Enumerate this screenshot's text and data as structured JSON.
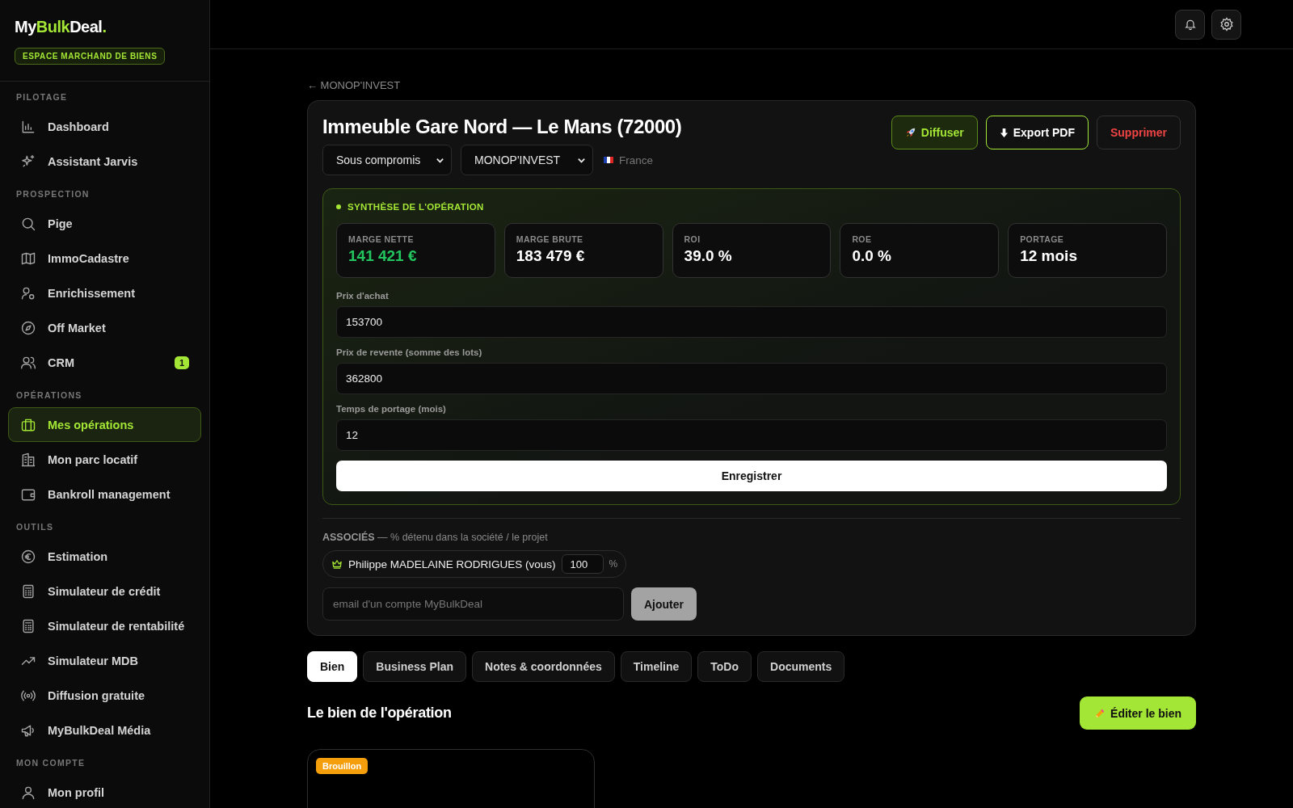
{
  "logo": {
    "parts": [
      {
        "text": "My",
        "accent": false
      },
      {
        "text": "Bulk",
        "accent": true
      },
      {
        "text": "Deal",
        "accent": false
      },
      {
        "text": ".",
        "accent": true
      }
    ]
  },
  "space_badge": "ESPACE MARCHAND DE BIENS",
  "sidebar": {
    "sections": [
      {
        "title": "PILOTAGE",
        "items": [
          {
            "label": "Dashboard",
            "selected": false
          },
          {
            "label": "Assistant Jarvis",
            "selected": false
          }
        ]
      },
      {
        "title": "PROSPECTION",
        "items": [
          {
            "label": "Pige",
            "selected": false
          },
          {
            "label": "ImmoCadastre",
            "selected": false
          },
          {
            "label": "Enrichissement",
            "selected": false
          },
          {
            "label": "Off Market",
            "selected": false
          },
          {
            "label": "CRM",
            "selected": false,
            "badge": "1"
          }
        ]
      },
      {
        "title": "OPÉRATIONS",
        "items": [
          {
            "label": "Mes opérations",
            "selected": true
          },
          {
            "label": "Mon parc locatif",
            "selected": false
          },
          {
            "label": "Bankroll management",
            "selected": false
          }
        ]
      },
      {
        "title": "OUTILS",
        "items": [
          {
            "label": "Estimation",
            "selected": false
          },
          {
            "label": "Simulateur de crédit",
            "selected": false
          },
          {
            "label": "Simulateur de rentabilité",
            "selected": false
          },
          {
            "label": "Simulateur MDB",
            "selected": false
          },
          {
            "label": "Diffusion gratuite",
            "selected": false
          },
          {
            "label": "MyBulkDeal Média",
            "selected": false
          }
        ]
      },
      {
        "title": "MON COMPTE",
        "items": [
          {
            "label": "Mon profil",
            "selected": false
          }
        ]
      }
    ]
  },
  "back_link": "← MONOP'INVEST",
  "operation": {
    "title": "Immeuble Gare Nord — Le Mans (72000)",
    "status": "Sous compromis",
    "company": "MONOP'INVEST",
    "country": "France",
    "actions": [
      {
        "label": "Diffuser",
        "kind": "share"
      },
      {
        "label": "Export PDF",
        "kind": "export"
      },
      {
        "label": "Supprimer",
        "kind": "delete"
      }
    ],
    "synthesis": {
      "title": "SYNTHÈSE DE L'OPÉRATION",
      "kpis": [
        {
          "label": "MARGE NETTE",
          "value": "141 421 €",
          "positive": true
        },
        {
          "label": "MARGE BRUTE",
          "value": "183 479 €",
          "positive": false
        },
        {
          "label": "ROI",
          "value": "39.0 %",
          "positive": false
        },
        {
          "label": "ROE",
          "value": "0.0 %",
          "positive": false
        },
        {
          "label": "PORTAGE",
          "value": "12 mois",
          "positive": false
        }
      ],
      "fields": [
        {
          "label": "Prix d'achat",
          "value": "153700"
        },
        {
          "label": "Prix de revente (somme des lots)",
          "value": "362800"
        },
        {
          "label": "Temps de portage (mois)",
          "value": "12"
        }
      ],
      "save_button": "Enregistrer"
    },
    "associates": {
      "title": "ASSOCIÉS",
      "subtitle": "— % détenu dans la société / le projet",
      "members": [
        {
          "name": "Philippe MADELAINE RODRIGUES (vous)",
          "share": "100",
          "unit": "%"
        }
      ],
      "email_placeholder": "email d'un compte MyBulkDeal",
      "add_button": "Ajouter"
    }
  },
  "tabs": [
    {
      "label": "Bien",
      "selected": true
    },
    {
      "label": "Business Plan",
      "selected": false
    },
    {
      "label": "Notes & coordonnées",
      "selected": false
    },
    {
      "label": "Timeline",
      "selected": false
    },
    {
      "label": "ToDo",
      "selected": false
    },
    {
      "label": "Documents",
      "selected": false
    }
  ],
  "section": {
    "title": "Le bien de l'opération",
    "edit_button": "Éditer le bien"
  },
  "property_card": {
    "status_badge": "Brouillon"
  }
}
